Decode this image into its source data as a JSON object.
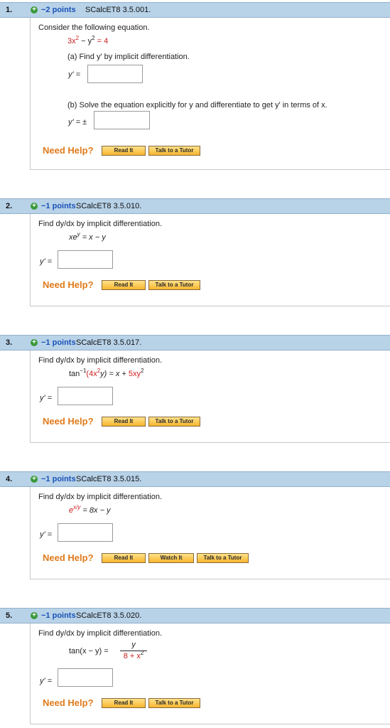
{
  "questions": [
    {
      "num": "1.",
      "points": "−2 points",
      "code": "SCalcET8 3.5.001.",
      "prompt": "Consider the following equation.",
      "eq_a": "3x",
      "eq_b": "2",
      "eq_c": "− y",
      "eq_d": "2",
      "eq_e": "= 4",
      "part_a": "(a) Find  y'  by implicit differentiation.",
      "label_a": "y' =",
      "part_b": "(b) Solve the equation explicitly for y and differentiate to get  y'  in terms of x.",
      "label_b": "y' = ±",
      "help": "Need Help?",
      "btn1": "Read It",
      "btn2": "Talk to a Tutor"
    },
    {
      "num": "2.",
      "points": "−1 points",
      "code": "SCalcET8 3.5.010.",
      "prompt": "Find dy/dx by implicit differentiation.",
      "eq_a": "xe",
      "eq_b": "y",
      "eq_c": "= x − y",
      "label": "y' =",
      "help": "Need Help?",
      "btn1": "Read It",
      "btn2": "Talk to a Tutor"
    },
    {
      "num": "3.",
      "points": "−1 points",
      "code": "SCalcET8 3.5.017.",
      "prompt": "Find dy/dx  by implicit differentiation.",
      "eq_a": "tan",
      "eq_b": "−1",
      "eq_c": "(4x",
      "eq_d": "2",
      "eq_e": "y)",
      "eq_f": "= x +",
      "eq_g": "5xy",
      "eq_h": "2",
      "label": "y' =",
      "help": "Need Help?",
      "btn1": "Read It",
      "btn2": "Talk to a Tutor"
    },
    {
      "num": "4.",
      "points": "−1 points",
      "code": "SCalcET8 3.5.015.",
      "prompt": "Find dy/dx by implicit differentiation.",
      "eq_a": "e",
      "eq_b": "x/y",
      "eq_c": "= 8x − y",
      "label": "y' =",
      "help": "Need Help?",
      "btn1": "Read It",
      "btn2": "Watch It",
      "btn3": "Talk to a Tutor"
    },
    {
      "num": "5.",
      "points": "−1 points",
      "code": "SCalcET8 3.5.020.",
      "prompt": "Find dy/dx by implicit differentiation.",
      "eq_a": "tan(x − y) =",
      "num_top": "y",
      "den_a": "8 + x",
      "den_b": "2",
      "label": "y' =",
      "help": "Need Help?",
      "btn1": "Read It",
      "btn2": "Talk to a Tutor"
    }
  ]
}
